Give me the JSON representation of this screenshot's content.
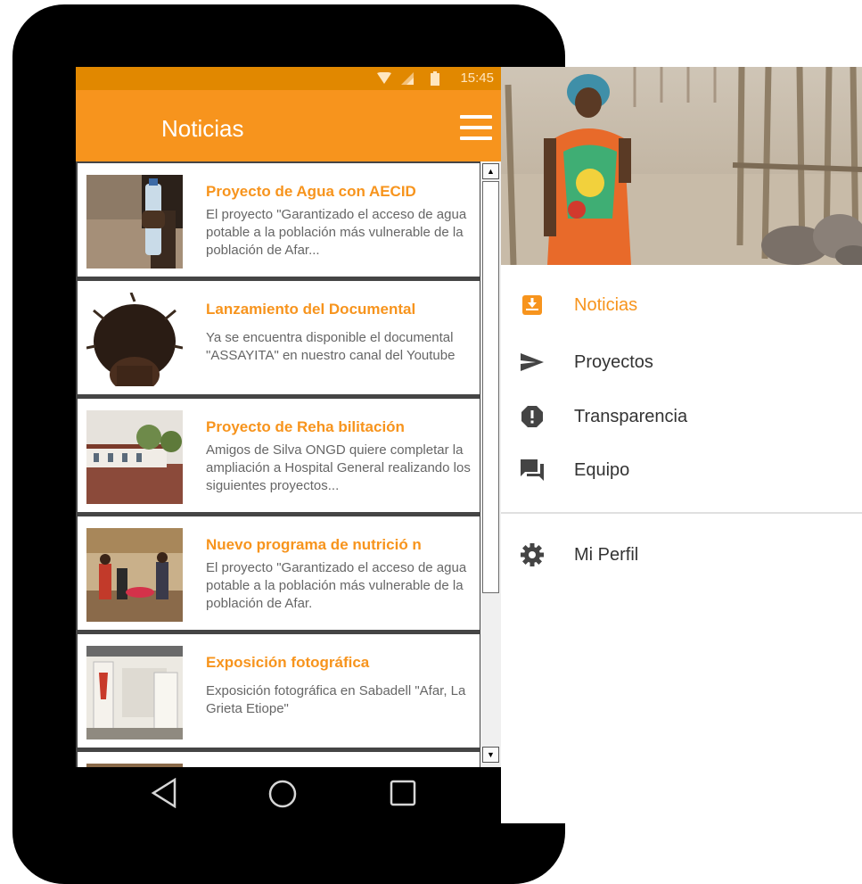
{
  "status_bar": {
    "time": "15:45"
  },
  "app_bar": {
    "title": "Noticias",
    "menu_icon": "hamburger-menu-icon"
  },
  "news": [
    {
      "title": "Proyecto de Agua con AECID",
      "description": "El proyecto \"Garantizado el acceso de agua potable a la población más vulnerable de la población de Afar..."
    },
    {
      "title": "Lanzamiento del Documental",
      "description": "Ya se encuentra disponible el documental \"ASSAYITA\" en nuestro canal del Youtube"
    },
    {
      "title": "Proyecto de Reha  bilitación",
      "description": "Amigos de Silva ONGD quiere completar la ampliación a Hospital General realizando los siguientes proyectos..."
    },
    {
      "title": "Nuevo programa de nutrició  n",
      "description": "El proyecto \"Garantizado el acceso de agua potable a la población más vulnerable de la población de Afar."
    },
    {
      "title": "Exposición fotográfica",
      "description": "Exposición fotográfica en Sabadell \"Afar, La Grieta Etiope\""
    }
  ],
  "drawer": {
    "items": [
      {
        "label": "Noticias",
        "icon": "inbox-icon"
      },
      {
        "label": "Proyectos",
        "icon": "send-icon"
      },
      {
        "label": "Transparencia",
        "icon": "alert-icon"
      },
      {
        "label": "Equipo",
        "icon": "chat-icon"
      }
    ],
    "profile": {
      "label": "Mi Perfil",
      "icon": "gear-icon"
    }
  },
  "colors": {
    "accent": "#f7941d",
    "status_bar": "#e18800",
    "text_dark": "#333333",
    "text_muted": "#666666"
  }
}
